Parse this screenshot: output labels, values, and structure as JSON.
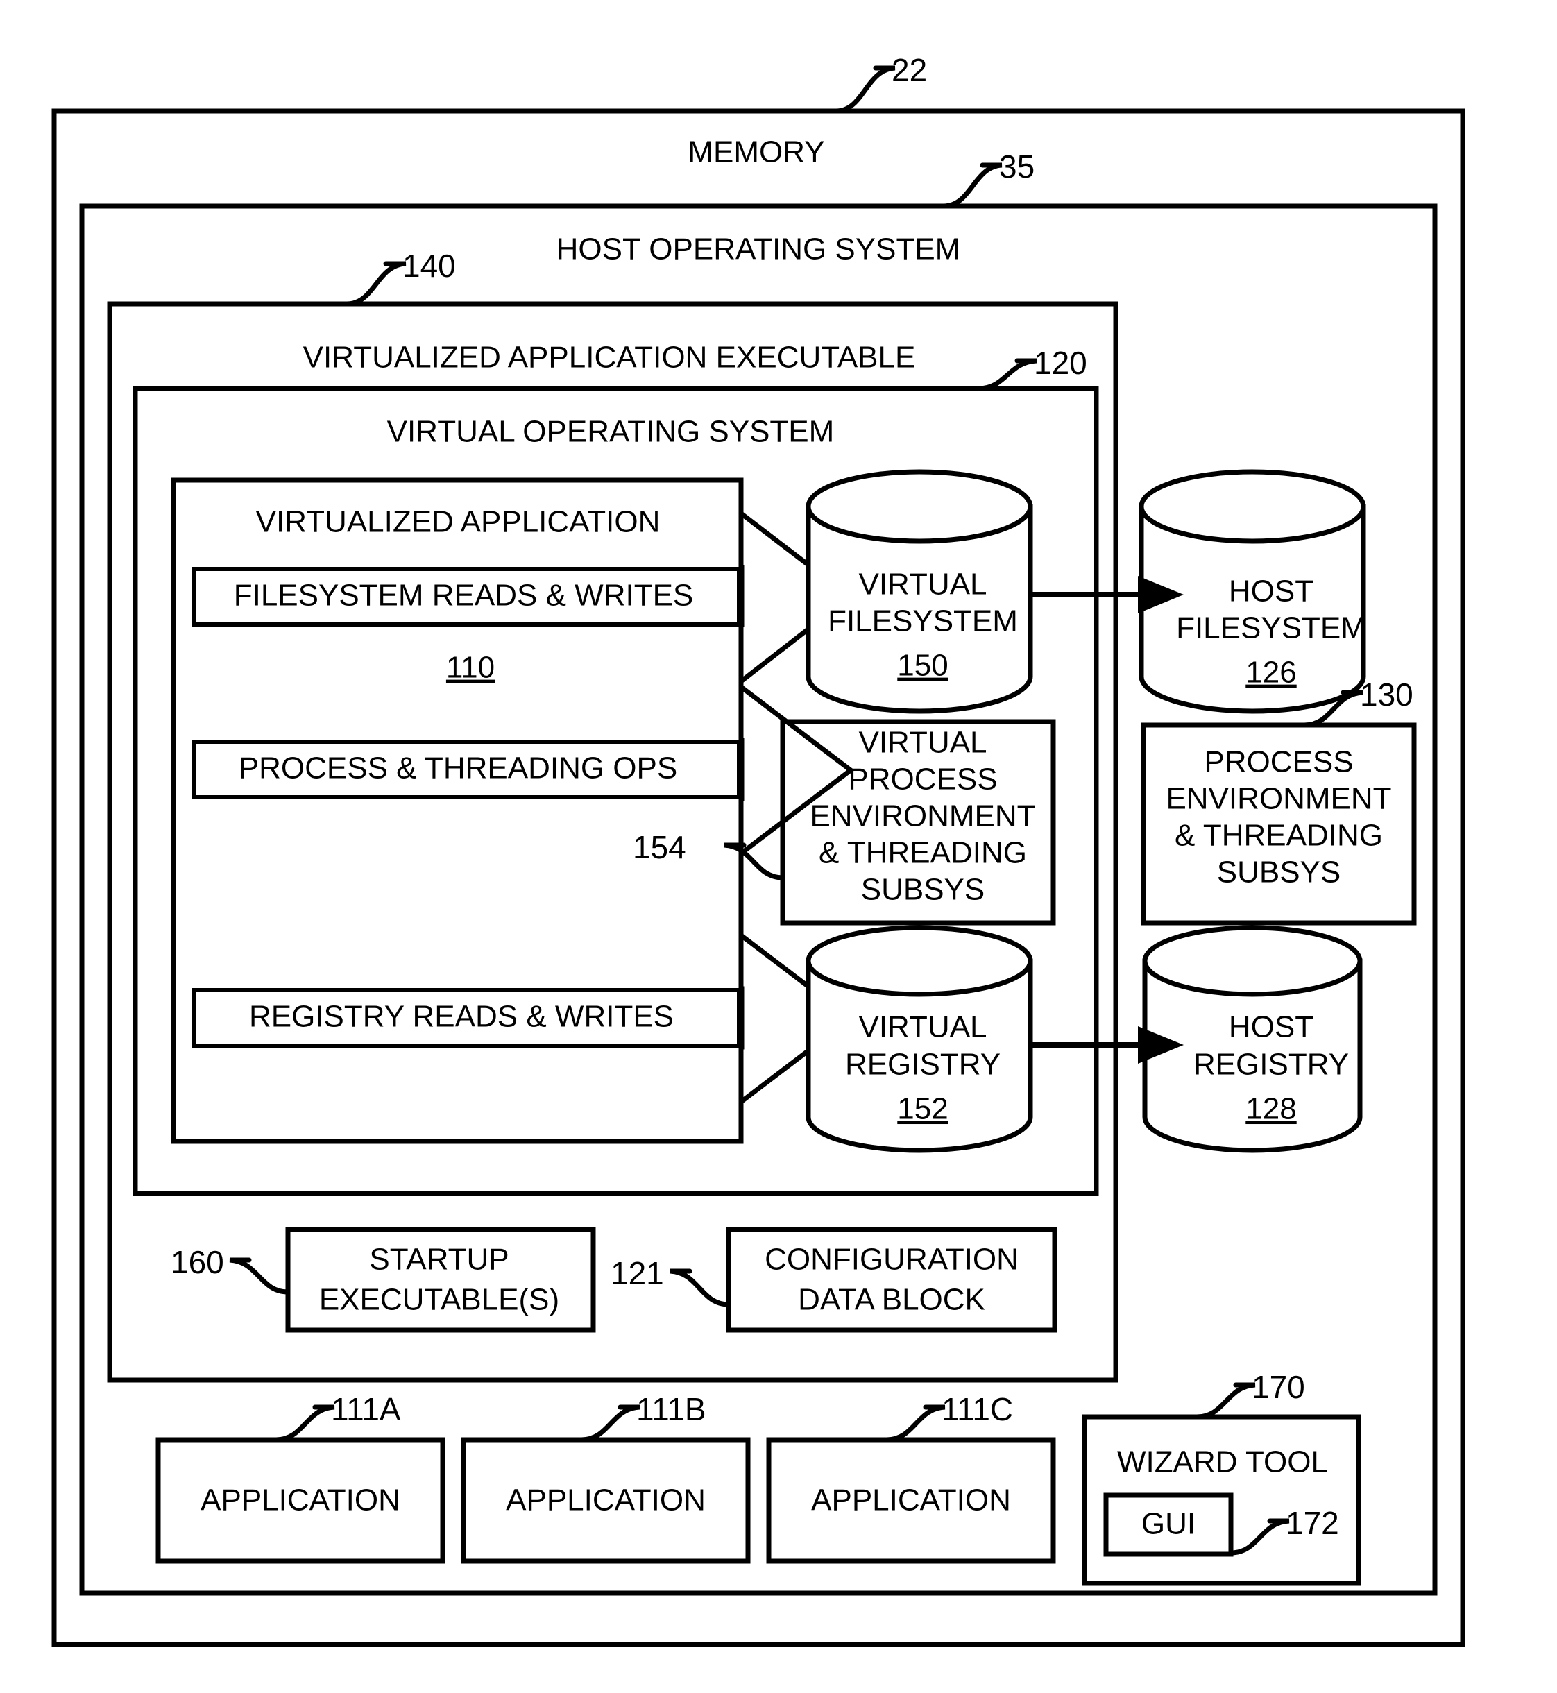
{
  "figure": {
    "domain_note": "patent-figure",
    "outer": {
      "title": "MEMORY",
      "ref": "22"
    },
    "host_os": {
      "title": "HOST OPERATING SYSTEM",
      "ref": "35"
    },
    "virtualized_app_exe": {
      "title": "VIRTUALIZED APPLICATION EXECUTABLE",
      "ref": "140"
    },
    "virtual_os": {
      "title": "VIRTUAL OPERATING SYSTEM",
      "ref": "120"
    },
    "virtualized_application": {
      "title": "VIRTUALIZED APPLICATION",
      "ref": "110",
      "operations": [
        {
          "label": "FILESYSTEM READS & WRITES"
        },
        {
          "label": "PROCESS & THREADING OPS"
        },
        {
          "label": "REGISTRY READS & WRITES"
        }
      ]
    },
    "virtual_filesystem": {
      "line1": "VIRTUAL",
      "line2": "FILESYSTEM",
      "ref": "150"
    },
    "host_filesystem": {
      "line1": "HOST",
      "line2": "FILESYSTEM",
      "ref": "126"
    },
    "virtual_process_env": {
      "lines": [
        "VIRTUAL",
        "PROCESS",
        "ENVIRONMENT",
        "& THREADING",
        "SUBSYS"
      ],
      "ref": "154"
    },
    "host_process_env": {
      "lines": [
        "PROCESS",
        "ENVIRONMENT",
        "& THREADING",
        "SUBSYS"
      ],
      "ref": "130"
    },
    "virtual_registry": {
      "line1": "VIRTUAL",
      "line2": "REGISTRY",
      "ref": "152"
    },
    "host_registry": {
      "line1": "HOST",
      "line2": "REGISTRY",
      "ref": "128"
    },
    "startup_executables": {
      "line1": "STARTUP",
      "line2": "EXECUTABLE(S)",
      "ref": "160"
    },
    "configuration_data_block": {
      "line1": "CONFIGURATION",
      "line2": "DATA BLOCK",
      "ref": "121"
    },
    "applications": [
      {
        "label": "APPLICATION",
        "ref": "111A"
      },
      {
        "label": "APPLICATION",
        "ref": "111B"
      },
      {
        "label": "APPLICATION",
        "ref": "111C"
      }
    ],
    "wizard_tool": {
      "title": "WIZARD TOOL",
      "ref": "170",
      "gui": {
        "label": "GUI",
        "ref": "172"
      }
    },
    "colors": {
      "stroke": "#000000",
      "fill": "#ffffff"
    }
  }
}
